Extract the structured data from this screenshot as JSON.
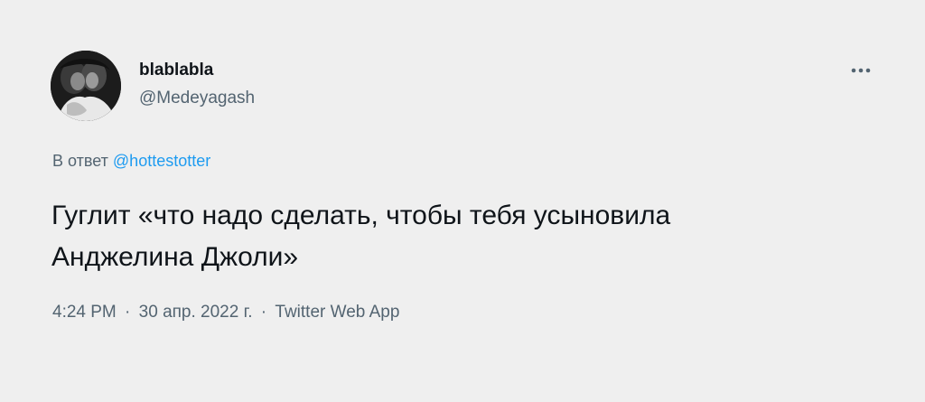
{
  "author": {
    "display_name": "blablabla",
    "handle": "@Medeyagash",
    "avatar_icon": "profile-photo"
  },
  "more_icon": "ellipsis-icon",
  "reply": {
    "prefix": "В ответ",
    "mention": "@hottestotter"
  },
  "tweet": {
    "line1": "Гуглит «что надо сделать, чтобы тебя усыновила",
    "line2": "Анджелина Джоли»"
  },
  "meta": {
    "time": "4:24 PM",
    "separator": "·",
    "date": "30 апр. 2022 г.",
    "source": "Twitter Web App"
  },
  "colors": {
    "background": "#efefef",
    "text_primary": "#0f1419",
    "text_secondary": "#536471",
    "link": "#1d9bf0"
  }
}
